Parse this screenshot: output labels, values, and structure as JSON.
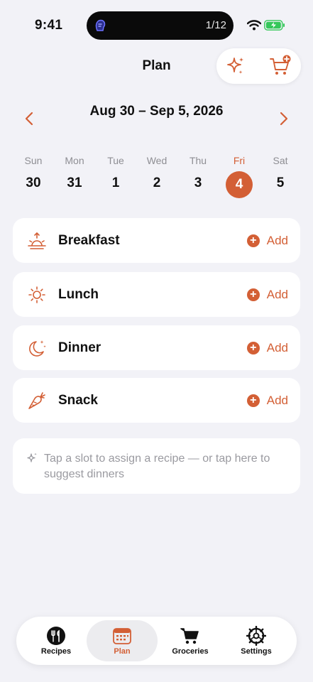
{
  "status_bar": {
    "time": "9:41",
    "activity_count": "1/12",
    "battery_color": "#34c759"
  },
  "header": {
    "title": "Plan",
    "actions": [
      {
        "icon": "sparkles-icon",
        "label": "Suggest"
      },
      {
        "icon": "cart-add-icon",
        "label": "Add to groceries"
      }
    ]
  },
  "week": {
    "range": "Aug 30 – Sep 5, 2026",
    "prev_icon": "chevron-left-icon",
    "next_icon": "chevron-right-icon",
    "days": [
      {
        "name": "Sun",
        "num": "30"
      },
      {
        "name": "Mon",
        "num": "31"
      },
      {
        "name": "Tue",
        "num": "1"
      },
      {
        "name": "Wed",
        "num": "2"
      },
      {
        "name": "Thu",
        "num": "3"
      },
      {
        "name": "Fri",
        "num": "4"
      },
      {
        "name": "Sat",
        "num": "5"
      }
    ],
    "selected_day": "Fri"
  },
  "meals": [
    {
      "label": "Breakfast",
      "icon": "sunrise-icon",
      "action": "Add"
    },
    {
      "label": "Lunch",
      "icon": "sun-icon",
      "action": "Add"
    },
    {
      "label": "Dinner",
      "icon": "moon-stars-icon",
      "action": "Add"
    },
    {
      "label": "Snack",
      "icon": "carrot-icon",
      "action": "Add"
    }
  ],
  "suggestion": {
    "icon": "sparkles-icon",
    "text": "Tap a slot to assign a recipe — or tap here to suggest dinners"
  },
  "tabs": [
    {
      "label": "Recipes",
      "icon": "fork-knife-icon"
    },
    {
      "label": "Plan",
      "icon": "calendar-icon"
    },
    {
      "label": "Groceries",
      "icon": "cart-icon"
    },
    {
      "label": "Settings",
      "icon": "gear-icon"
    }
  ],
  "active_tab": "Plan",
  "colors": {
    "accent": "#d35f35",
    "background": "#f2f2f7",
    "card": "#ffffff",
    "muted_text": "#8e8e93"
  }
}
